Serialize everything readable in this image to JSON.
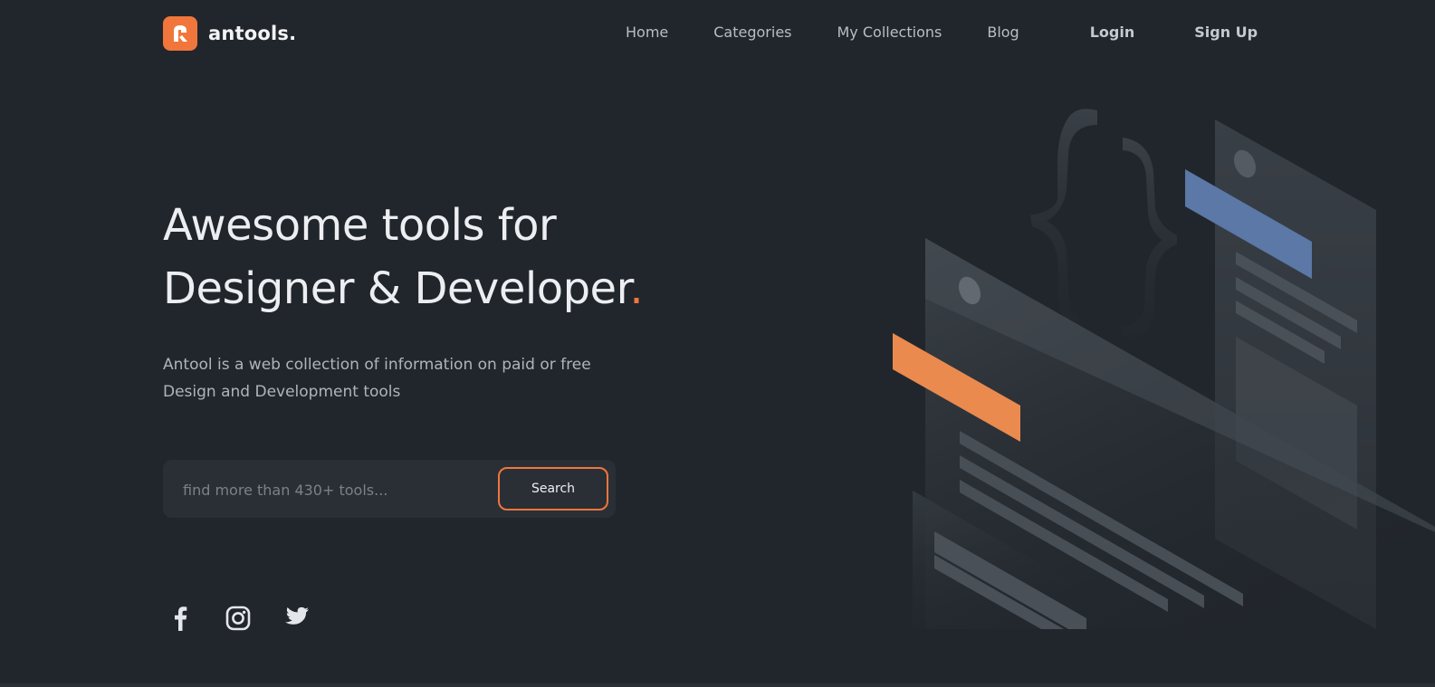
{
  "brand": {
    "name": "antools.",
    "logo_icon": "antools-logo-icon",
    "accent_color": "#f0763c"
  },
  "nav": {
    "links": [
      {
        "label": "Home"
      },
      {
        "label": "Categories"
      },
      {
        "label": "My Collections"
      },
      {
        "label": "Blog"
      }
    ],
    "login_label": "Login",
    "signup_label": "Sign Up"
  },
  "hero": {
    "title_line1": "Awesome tools for",
    "title_line2": "Designer & Developer",
    "title_dot": ".",
    "description": "Antool is a web collection of information on paid or free Design and Development tools"
  },
  "search": {
    "placeholder": "find more than 430+ tools...",
    "value": "",
    "button_label": "Search"
  },
  "socials": [
    {
      "icon": "facebook-icon"
    },
    {
      "icon": "instagram-icon"
    },
    {
      "icon": "twitter-icon"
    }
  ],
  "colors": {
    "background": "#21262c",
    "panel": "#2a2f36",
    "accent_orange": "#f0763c",
    "accent_blue": "#5b78a6"
  }
}
